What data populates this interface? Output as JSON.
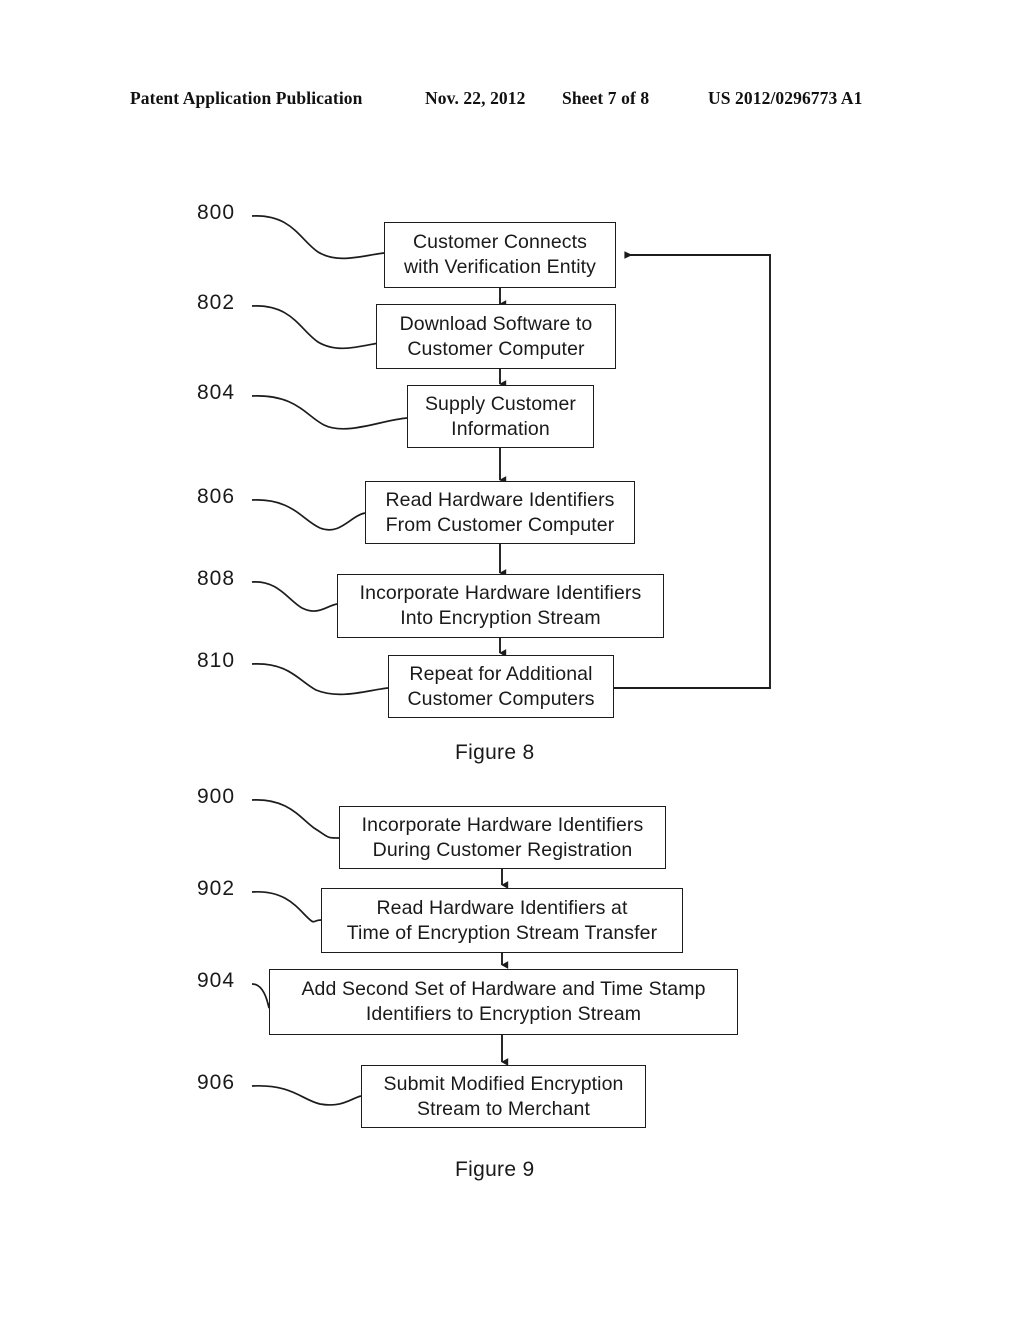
{
  "header": {
    "publication": "Patent Application Publication",
    "date": "Nov. 22, 2012",
    "sheet": "Sheet 7 of 8",
    "patent_number": "US 2012/0296773 A1"
  },
  "figures": [
    {
      "caption": "Figure 8",
      "nodes": [
        {
          "ref": "800",
          "line1": "Customer Connects",
          "line2": "with Verification Entity"
        },
        {
          "ref": "802",
          "line1": "Download Software to",
          "line2": "Customer Computer"
        },
        {
          "ref": "804",
          "line1": "Supply Customer",
          "line2": "Information"
        },
        {
          "ref": "806",
          "line1": "Read Hardware Identifiers",
          "line2": "From Customer Computer"
        },
        {
          "ref": "808",
          "line1": "Incorporate Hardware Identifiers",
          "line2": "Into Encryption Stream"
        },
        {
          "ref": "810",
          "line1": "Repeat for Additional",
          "line2": "Customer Computers"
        }
      ]
    },
    {
      "caption": "Figure 9",
      "nodes": [
        {
          "ref": "900",
          "line1": "Incorporate Hardware Identifiers",
          "line2": "During Customer Registration"
        },
        {
          "ref": "902",
          "line1": "Read Hardware Identifiers at",
          "line2": "Time of Encryption Stream Transfer"
        },
        {
          "ref": "904",
          "line1": "Add Second Set of Hardware and Time Stamp",
          "line2": "Identifiers to Encryption Stream"
        },
        {
          "ref": "906",
          "line1": "Submit Modified Encryption",
          "line2": "Stream to Merchant"
        }
      ]
    }
  ],
  "colors": {
    "ink": "#1a1a1a",
    "paper": "#ffffff"
  }
}
